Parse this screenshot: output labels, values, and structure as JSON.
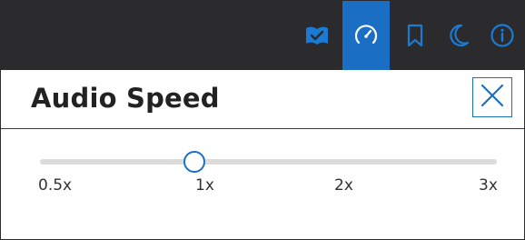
{
  "toolbar": {
    "buttons": [
      {
        "name": "book-check-icon",
        "active": false
      },
      {
        "name": "speedometer-icon",
        "active": true
      },
      {
        "name": "bookmark-icon",
        "active": false
      },
      {
        "name": "moon-icon",
        "active": false
      },
      {
        "name": "info-icon",
        "active": false
      }
    ],
    "background_color": "#2b2b2d",
    "active_color": "#1a6fc4",
    "icon_color": "#1a7bd6"
  },
  "panel": {
    "title": "Audio Speed",
    "close_icon": "close-icon"
  },
  "speed_slider": {
    "ticks": [
      "0.5x",
      "1x",
      "2x",
      "3x"
    ],
    "current_value": "1x"
  }
}
